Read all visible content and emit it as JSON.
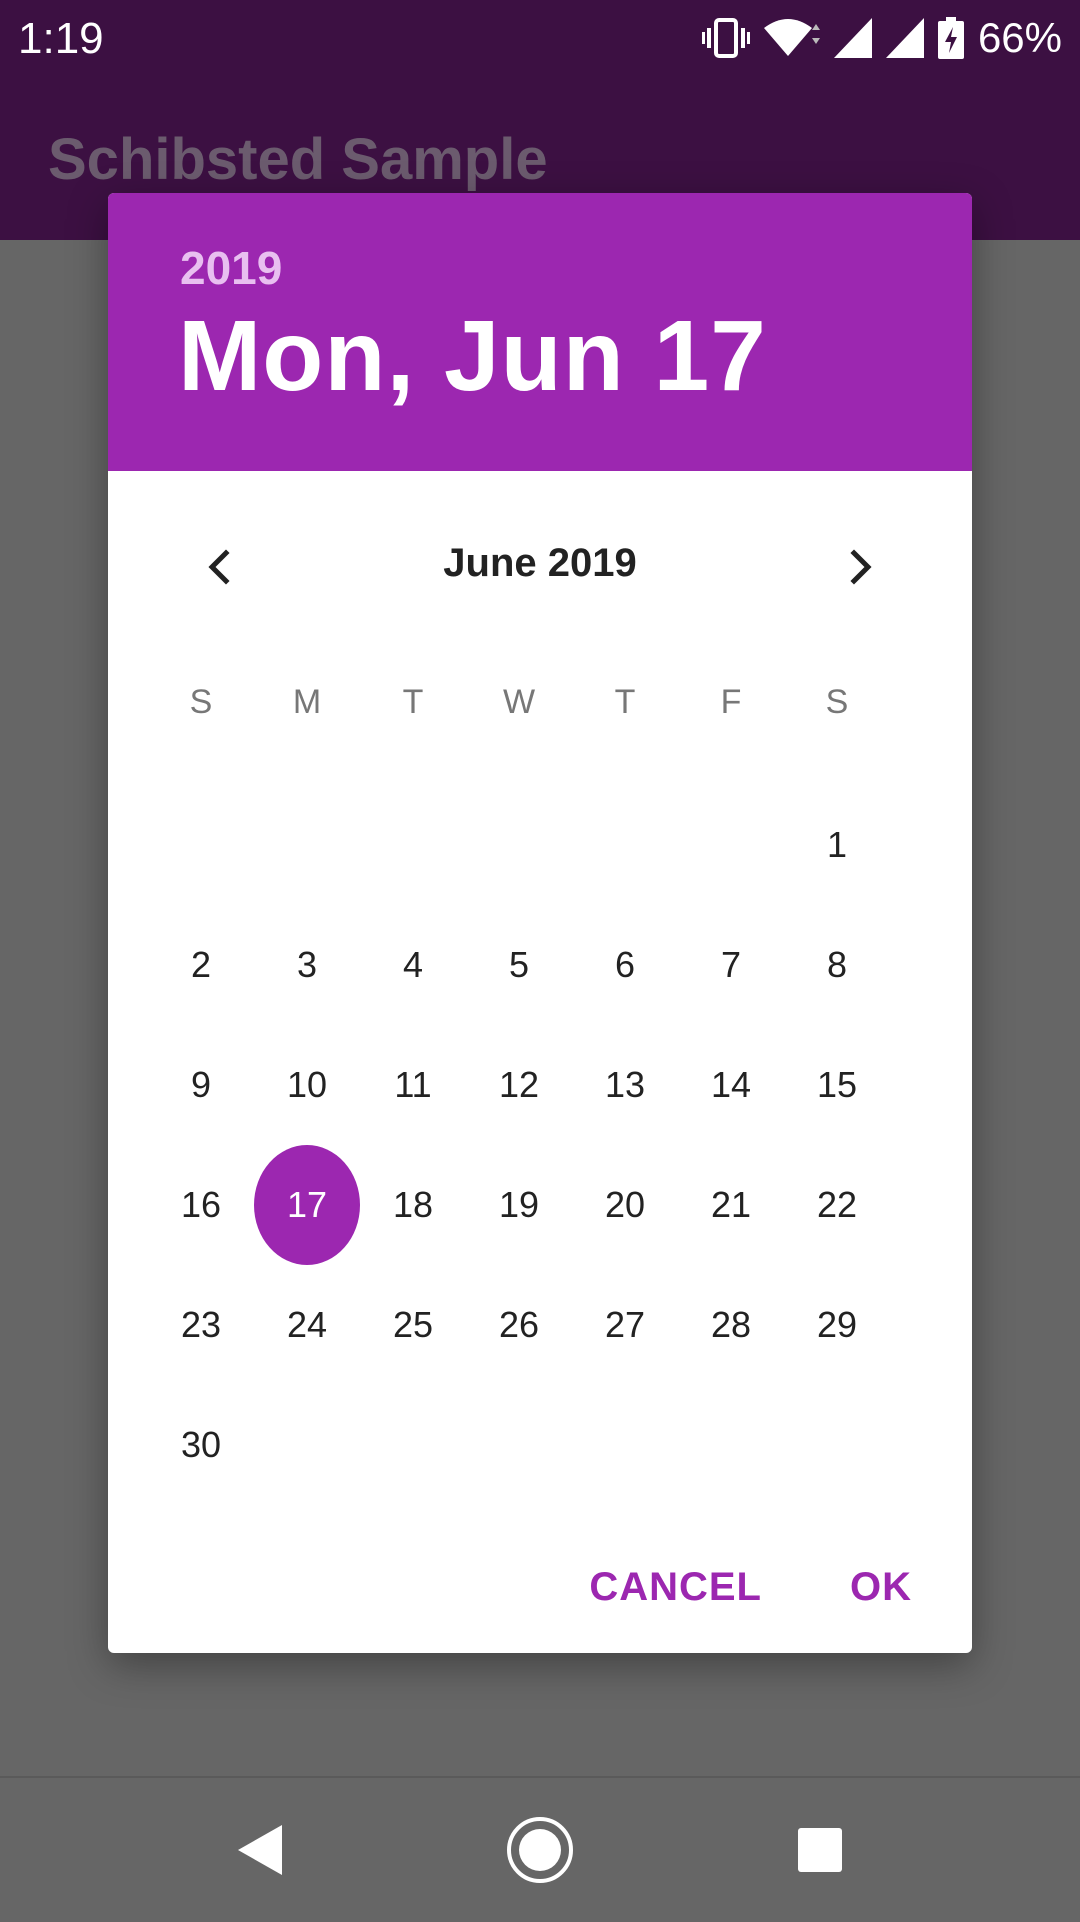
{
  "status_bar": {
    "time": "1:19",
    "battery_percent": "66%",
    "icons": [
      "vibrate-icon",
      "wifi-icon",
      "signal-icon",
      "signal-icon",
      "battery-charging-icon"
    ]
  },
  "app_bar": {
    "title": "Schibsted Sample",
    "background": "#3c1042"
  },
  "dialog": {
    "header": {
      "year": "2019",
      "date": "Mon, Jun 17",
      "background": "#9c27b0"
    },
    "month_label": "June 2019",
    "weekdays": [
      "S",
      "M",
      "T",
      "W",
      "T",
      "F",
      "S"
    ],
    "first_weekday_index": 6,
    "days": [
      "1",
      "2",
      "3",
      "4",
      "5",
      "6",
      "7",
      "8",
      "9",
      "10",
      "11",
      "12",
      "13",
      "14",
      "15",
      "16",
      "17",
      "18",
      "19",
      "20",
      "21",
      "22",
      "23",
      "24",
      "25",
      "26",
      "27",
      "28",
      "29",
      "30"
    ],
    "selected_day": "17",
    "actions": {
      "cancel": "CANCEL",
      "ok": "OK"
    },
    "accent": "#9c27b0"
  },
  "nav_bar": {
    "icons": [
      "back-icon",
      "home-icon",
      "recents-icon"
    ]
  }
}
